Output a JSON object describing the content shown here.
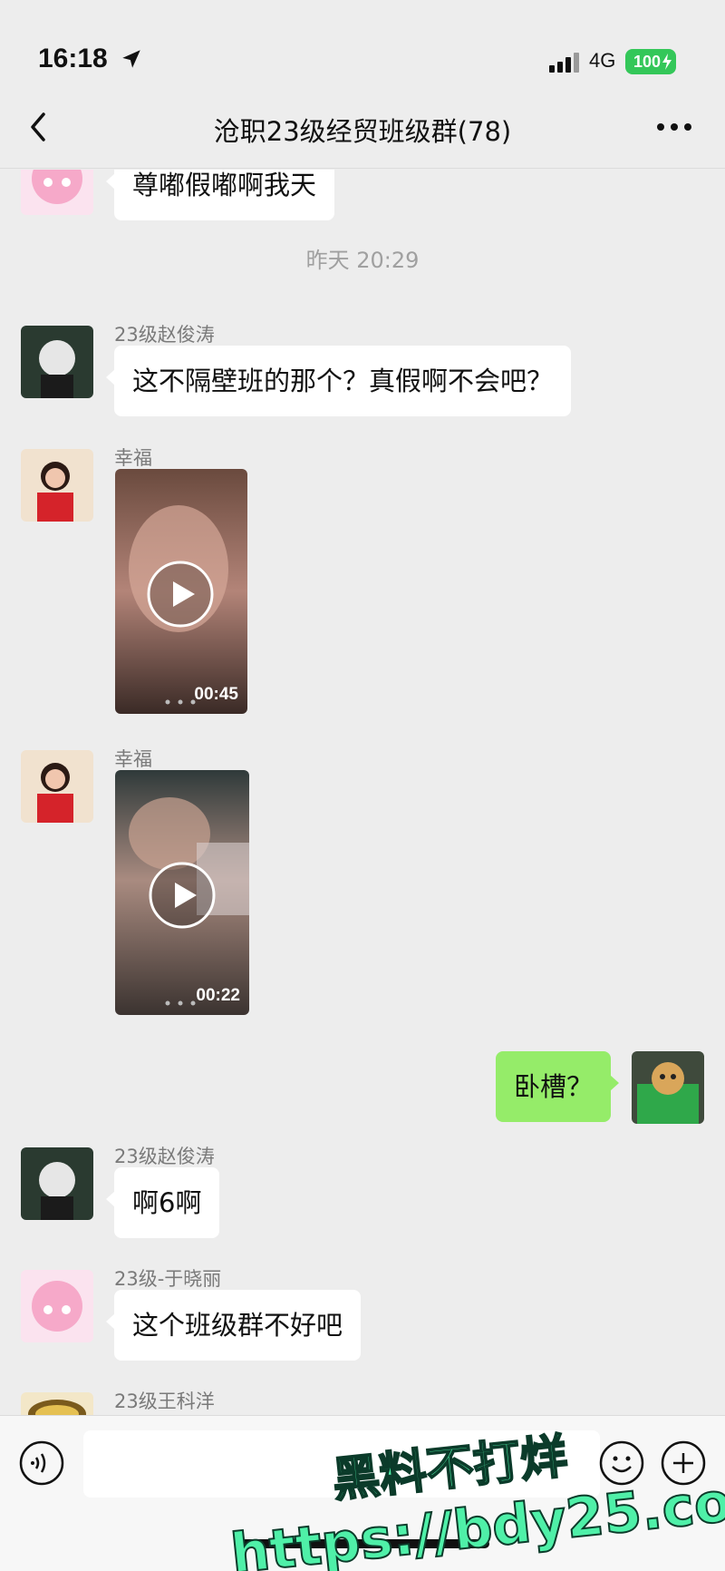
{
  "status_bar": {
    "time": "16:18",
    "network": "4G",
    "battery": "100"
  },
  "nav": {
    "title": "沧职23级经贸班级群(78)"
  },
  "chat": {
    "messages": [
      {
        "sender": "",
        "text": "尊嘟假嘟啊我天"
      },
      {
        "timestamp": "昨天 20:29"
      },
      {
        "sender": "23级赵俊涛",
        "text": "这不隔壁班的那个？真假啊不会吧？"
      },
      {
        "sender": "幸福",
        "video_duration": "00:45"
      },
      {
        "sender": "幸福",
        "video_duration": "00:22"
      },
      {
        "sender": "self",
        "text": "卧槽？"
      },
      {
        "sender": "23级赵俊涛",
        "text": "啊6啊"
      },
      {
        "sender": "23级-于晓丽",
        "text": "这个班级群不好吧"
      },
      {
        "sender": "23级王科洋"
      }
    ]
  },
  "watermark": {
    "line1": "黑料不打烊",
    "line2": "https://bdy25.co"
  },
  "colors": {
    "background": "#ededed",
    "self_bubble": "#95ec69",
    "other_bubble": "#ffffff",
    "battery": "#34c759",
    "watermark": "#4ff0a8"
  },
  "icons": [
    "location-arrow-icon",
    "signal-icon",
    "battery-icon",
    "back-icon",
    "more-icon",
    "play-icon",
    "voice-icon",
    "emoji-icon",
    "plus-icon"
  ]
}
